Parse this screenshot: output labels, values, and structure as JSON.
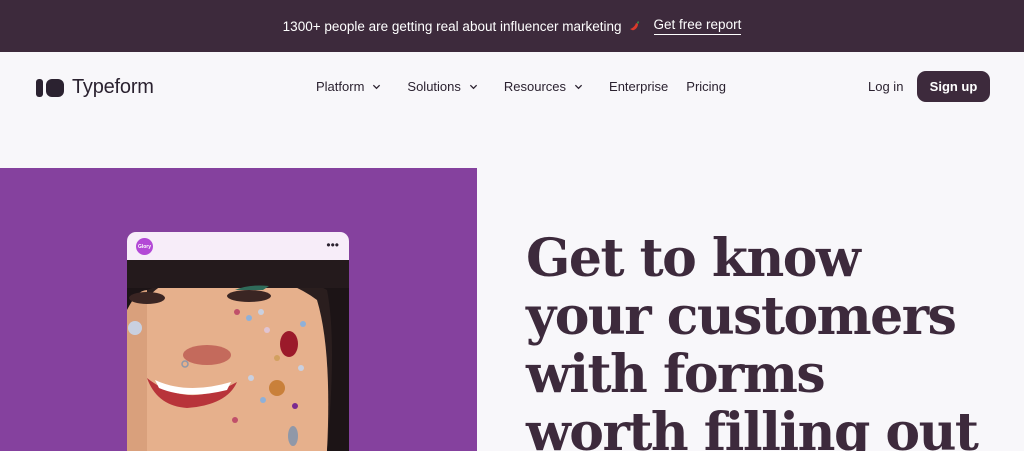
{
  "announcement": {
    "text": "1300+ people are getting real about influencer marketing",
    "emoji_icon": "chili-pepper-icon",
    "link_label": "Get free report"
  },
  "header": {
    "logo_text": "Typeform",
    "nav": [
      {
        "label": "Platform",
        "has_dropdown": true
      },
      {
        "label": "Solutions",
        "has_dropdown": true
      },
      {
        "label": "Resources",
        "has_dropdown": true
      },
      {
        "label": "Enterprise",
        "has_dropdown": false
      },
      {
        "label": "Pricing",
        "has_dropdown": false
      }
    ],
    "login_label": "Log in",
    "signup_label": "Sign up"
  },
  "hero": {
    "card": {
      "avatar_text": "Glory",
      "menu_icon": "more-dots-icon"
    },
    "headline_lines": [
      "Get to know",
      "your customers",
      "with forms",
      "worth filling out"
    ]
  },
  "colors": {
    "announcement_bg": "#3d2a3c",
    "page_bg": "#f8f7fa",
    "hero_panel": "#85419e",
    "brand_dark": "#3d2a3c"
  }
}
